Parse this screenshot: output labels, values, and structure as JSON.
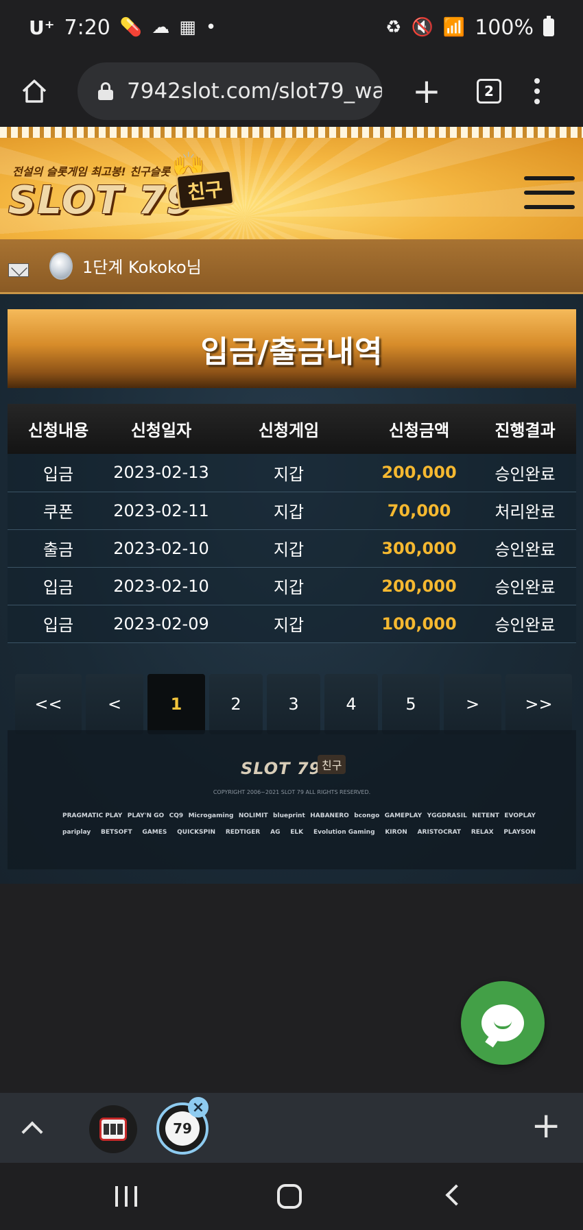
{
  "status_bar": {
    "carrier": "U⁺",
    "time": "7:20",
    "battery": "100%"
  },
  "browser": {
    "url": "7942slot.com/slot79_wa",
    "tab_count": "2"
  },
  "site": {
    "slogan": "전설의 슬롯게임 최고봉! 친구슬롯",
    "logo_text": "SLOT 79",
    "logo_badge": "친구"
  },
  "user": {
    "level_text": "1단계 Kokoko님"
  },
  "main": {
    "title": "입금/출금내역",
    "table": {
      "headers": [
        "신청내용",
        "신청일자",
        "신청게임",
        "신청금액",
        "진행결과"
      ],
      "rows": [
        [
          "입금",
          "2023-02-13",
          "지갑",
          "200,000",
          "승인완료"
        ],
        [
          "쿠폰",
          "2023-02-11",
          "지갑",
          "70,000",
          "처리완료"
        ],
        [
          "출금",
          "2023-02-10",
          "지갑",
          "300,000",
          "승인완료"
        ],
        [
          "입금",
          "2023-02-10",
          "지갑",
          "200,000",
          "승인완료"
        ],
        [
          "입금",
          "2023-02-09",
          "지갑",
          "100,000",
          "승인완료"
        ]
      ]
    },
    "pagination": [
      "<<",
      "<",
      "1",
      "2",
      "3",
      "4",
      "5",
      ">",
      ">>"
    ],
    "active_page": "1"
  },
  "footer": {
    "logo_text": "SLOT 79",
    "logo_badge": "친구",
    "copyright": "COPYRIGHT  2006~2021 SLOT 79 ALL RIGHTS RESERVED.",
    "providers_row1": [
      "PRAGMATIC PLAY",
      "PLAY'N GO",
      "CQ9",
      "Microgaming",
      "NOLIMIT",
      "blueprint",
      "HABANERO",
      "bcongo",
      "GAMEPLAY",
      "YGGDRASIL",
      "NETENT",
      "EVOPLAY"
    ],
    "providers_row2": [
      "pariplay",
      "BETSOFT",
      "GAMES",
      "QUICKSPIN",
      "REDTIGER",
      "AG",
      "ELK",
      "Evolution Gaming",
      "KIRON",
      "ARISTOCRAT",
      "RELAX",
      "PLAYSON"
    ]
  },
  "colors": {
    "accent_gold": "#f5b830",
    "chat_green": "#43a047",
    "active_page": "#f2c43c"
  }
}
